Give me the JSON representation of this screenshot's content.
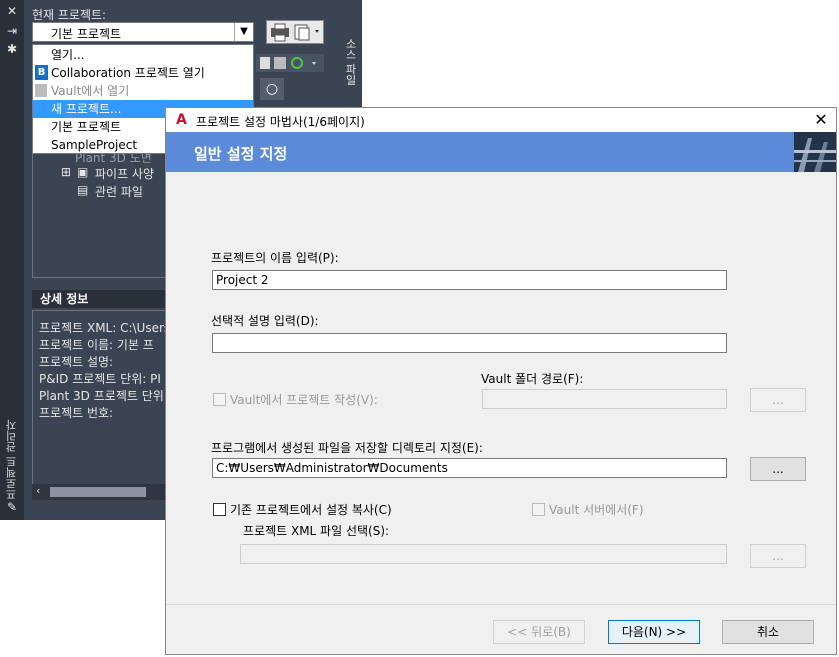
{
  "palette": {
    "current_project_label": "현재 프로젝트:",
    "current_project_value": "기본 프로젝트",
    "side_tab": "소스 파일",
    "vertical_title": "프로젝트 관리자",
    "tree": {
      "item_cut": "Plant 3D 도면",
      "pipe_spec": "파이프 사양",
      "related_files": "관련 파일"
    },
    "details_header": "상세 정보",
    "details": [
      "프로젝트 XML: C:\\Users",
      "프로젝트 이름: 기본 프",
      "프로젝트 설명:",
      "P&ID 프로젝트 단위: PI",
      "Plant 3D 프로젝트 단위",
      "프로젝트 번호:"
    ],
    "dropdown_items": [
      {
        "label": "열기...",
        "state": "normal"
      },
      {
        "label": "Collaboration 프로젝트 열기",
        "state": "normal"
      },
      {
        "label": "Vault에서 열기",
        "state": "disabled"
      },
      {
        "label": "새 프로젝트...",
        "state": "selected"
      },
      {
        "label": "기본 프로젝트",
        "state": "normal"
      },
      {
        "label": "SampleProject",
        "state": "normal"
      }
    ]
  },
  "wizard": {
    "title": "프로젝트 설정 마법사(1/6페이지)",
    "banner": "일반 설정 지정",
    "name_label": "프로젝트의 이름 입력(P):",
    "name_value": "Project 2",
    "desc_label": "선택적 설명 입력(D):",
    "desc_value": "",
    "vault_folder_label": "Vault 폴더 경로(F):",
    "vault_create_label": "Vault에서 프로젝트 작성(V):",
    "vault_browse": "...",
    "dir_label": "프로그램에서 생성된 파일을 저장할 디렉토리 지정(E):",
    "dir_value": "C:₩Users₩Administrator₩Documents",
    "dir_browse": "...",
    "copy_label": "기존 프로젝트에서 설정 복사(C)",
    "vault_server_label": "Vault 서버에서(F)",
    "xml_label": "프로젝트 XML 파일 선택(S):",
    "xml_browse": "...",
    "back": "<< 뒤로(B)",
    "next": "다음(N) >>",
    "cancel": "취소"
  }
}
